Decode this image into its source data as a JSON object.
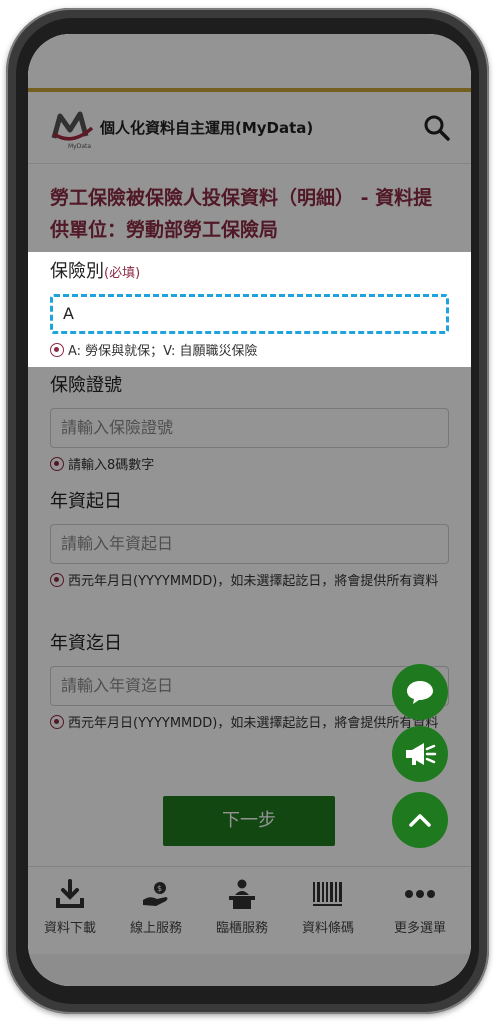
{
  "header": {
    "title": "個人化資料自主運用(MyData)",
    "logo_text": "MyData"
  },
  "page": {
    "title": "勞工保險被保險人投保資料（明細） - 資料提供單位：勞動部勞工保險局"
  },
  "fields": [
    {
      "label": "保險別",
      "required": "(必填)",
      "value": "A",
      "placeholder": "",
      "hint": "A: 勞保與就保；V: 自願職災保險"
    },
    {
      "label": "保險證號",
      "required": "",
      "value": "",
      "placeholder": "請輸入保險證號",
      "hint": "請輸入8碼數字"
    },
    {
      "label": "年資起日",
      "required": "",
      "value": "",
      "placeholder": "請輸入年資起日",
      "hint": "西元年月日(YYYYMMDD)，如未選擇起訖日，將會提供所有資料"
    },
    {
      "label": "年資迄日",
      "required": "",
      "value": "",
      "placeholder": "請輸入年資迄日",
      "hint": "西元年月日(YYYYMMDD)，如未選擇起訖日，將會提供所有資料"
    }
  ],
  "actions": {
    "next_label": "下一步"
  },
  "bottom_nav": [
    {
      "label": "資料下載",
      "icon": "download-icon"
    },
    {
      "label": "線上服務",
      "icon": "online-service-icon"
    },
    {
      "label": "臨櫃服務",
      "icon": "counter-service-icon"
    },
    {
      "label": "資料條碼",
      "icon": "barcode-icon"
    },
    {
      "label": "更多選單",
      "icon": "more-icon"
    }
  ],
  "floating_buttons": [
    {
      "icon": "chat-icon"
    },
    {
      "icon": "announcement-icon"
    },
    {
      "icon": "scroll-top-icon"
    }
  ],
  "colors": {
    "accent": "#8c2b46",
    "primary_green": "#1f7a1f",
    "focus_blue": "#1fa3df",
    "top_line_gold": "#c9a43a"
  }
}
